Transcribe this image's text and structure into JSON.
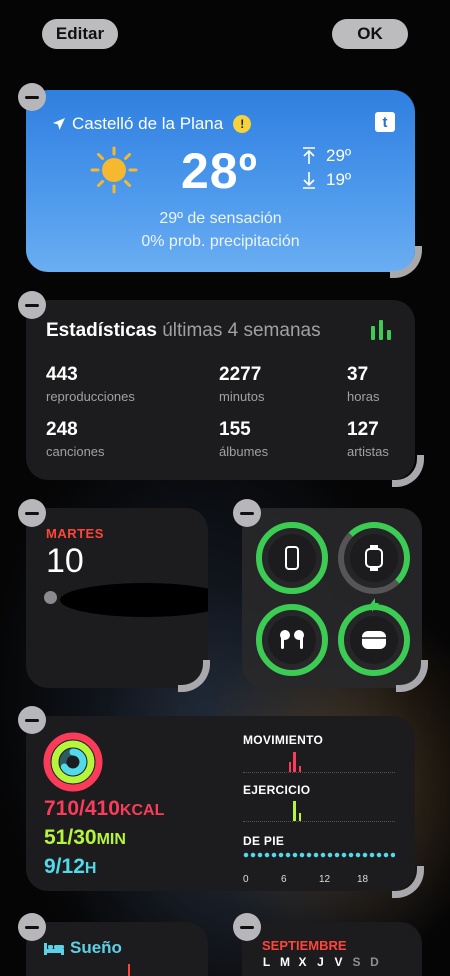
{
  "header": {
    "edit_label": "Editar",
    "ok_label": "OK"
  },
  "weather": {
    "location": "Castelló de la Plana",
    "temperature": "28º",
    "high": "29º",
    "low": "19º",
    "feels_like": "29º de sensación",
    "precipitation": "0% prob. precipitación",
    "provider_logo": "t"
  },
  "stats": {
    "title": "Estadísticas",
    "subtitle": "últimas 4 semanas",
    "items": [
      {
        "value": "443",
        "label": "reproducciones"
      },
      {
        "value": "2277",
        "label": "minutos"
      },
      {
        "value": "37",
        "label": "horas"
      },
      {
        "value": "248",
        "label": "canciones"
      },
      {
        "value": "155",
        "label": "álbumes"
      },
      {
        "value": "127",
        "label": "artistas"
      }
    ]
  },
  "calendar": {
    "weekday": "MARTES",
    "day": "10"
  },
  "batteries": {
    "devices": [
      "iphone",
      "apple-watch",
      "airpods-pro",
      "airpods-case"
    ],
    "levels": [
      1.0,
      0.8,
      1.0,
      1.0
    ]
  },
  "activity": {
    "move": "710/410",
    "move_unit": "KCAL",
    "exercise": "51/30",
    "exercise_unit": "MIN",
    "stand": "9/12",
    "stand_unit": "H",
    "move_label": "MOVIMIENTO",
    "exercise_label": "EJERCICIO",
    "stand_label": "DE PIE",
    "ticks": [
      "0",
      "6",
      "12",
      "18"
    ],
    "colors": {
      "move": "#fa3c5a",
      "exercise": "#b6f53e",
      "stand": "#52d9ea"
    }
  },
  "sleep": {
    "title": "Sueño"
  },
  "month": {
    "name": "SEPTIEMBRE",
    "days": [
      "L",
      "M",
      "X",
      "J",
      "V",
      "S",
      "D"
    ]
  }
}
